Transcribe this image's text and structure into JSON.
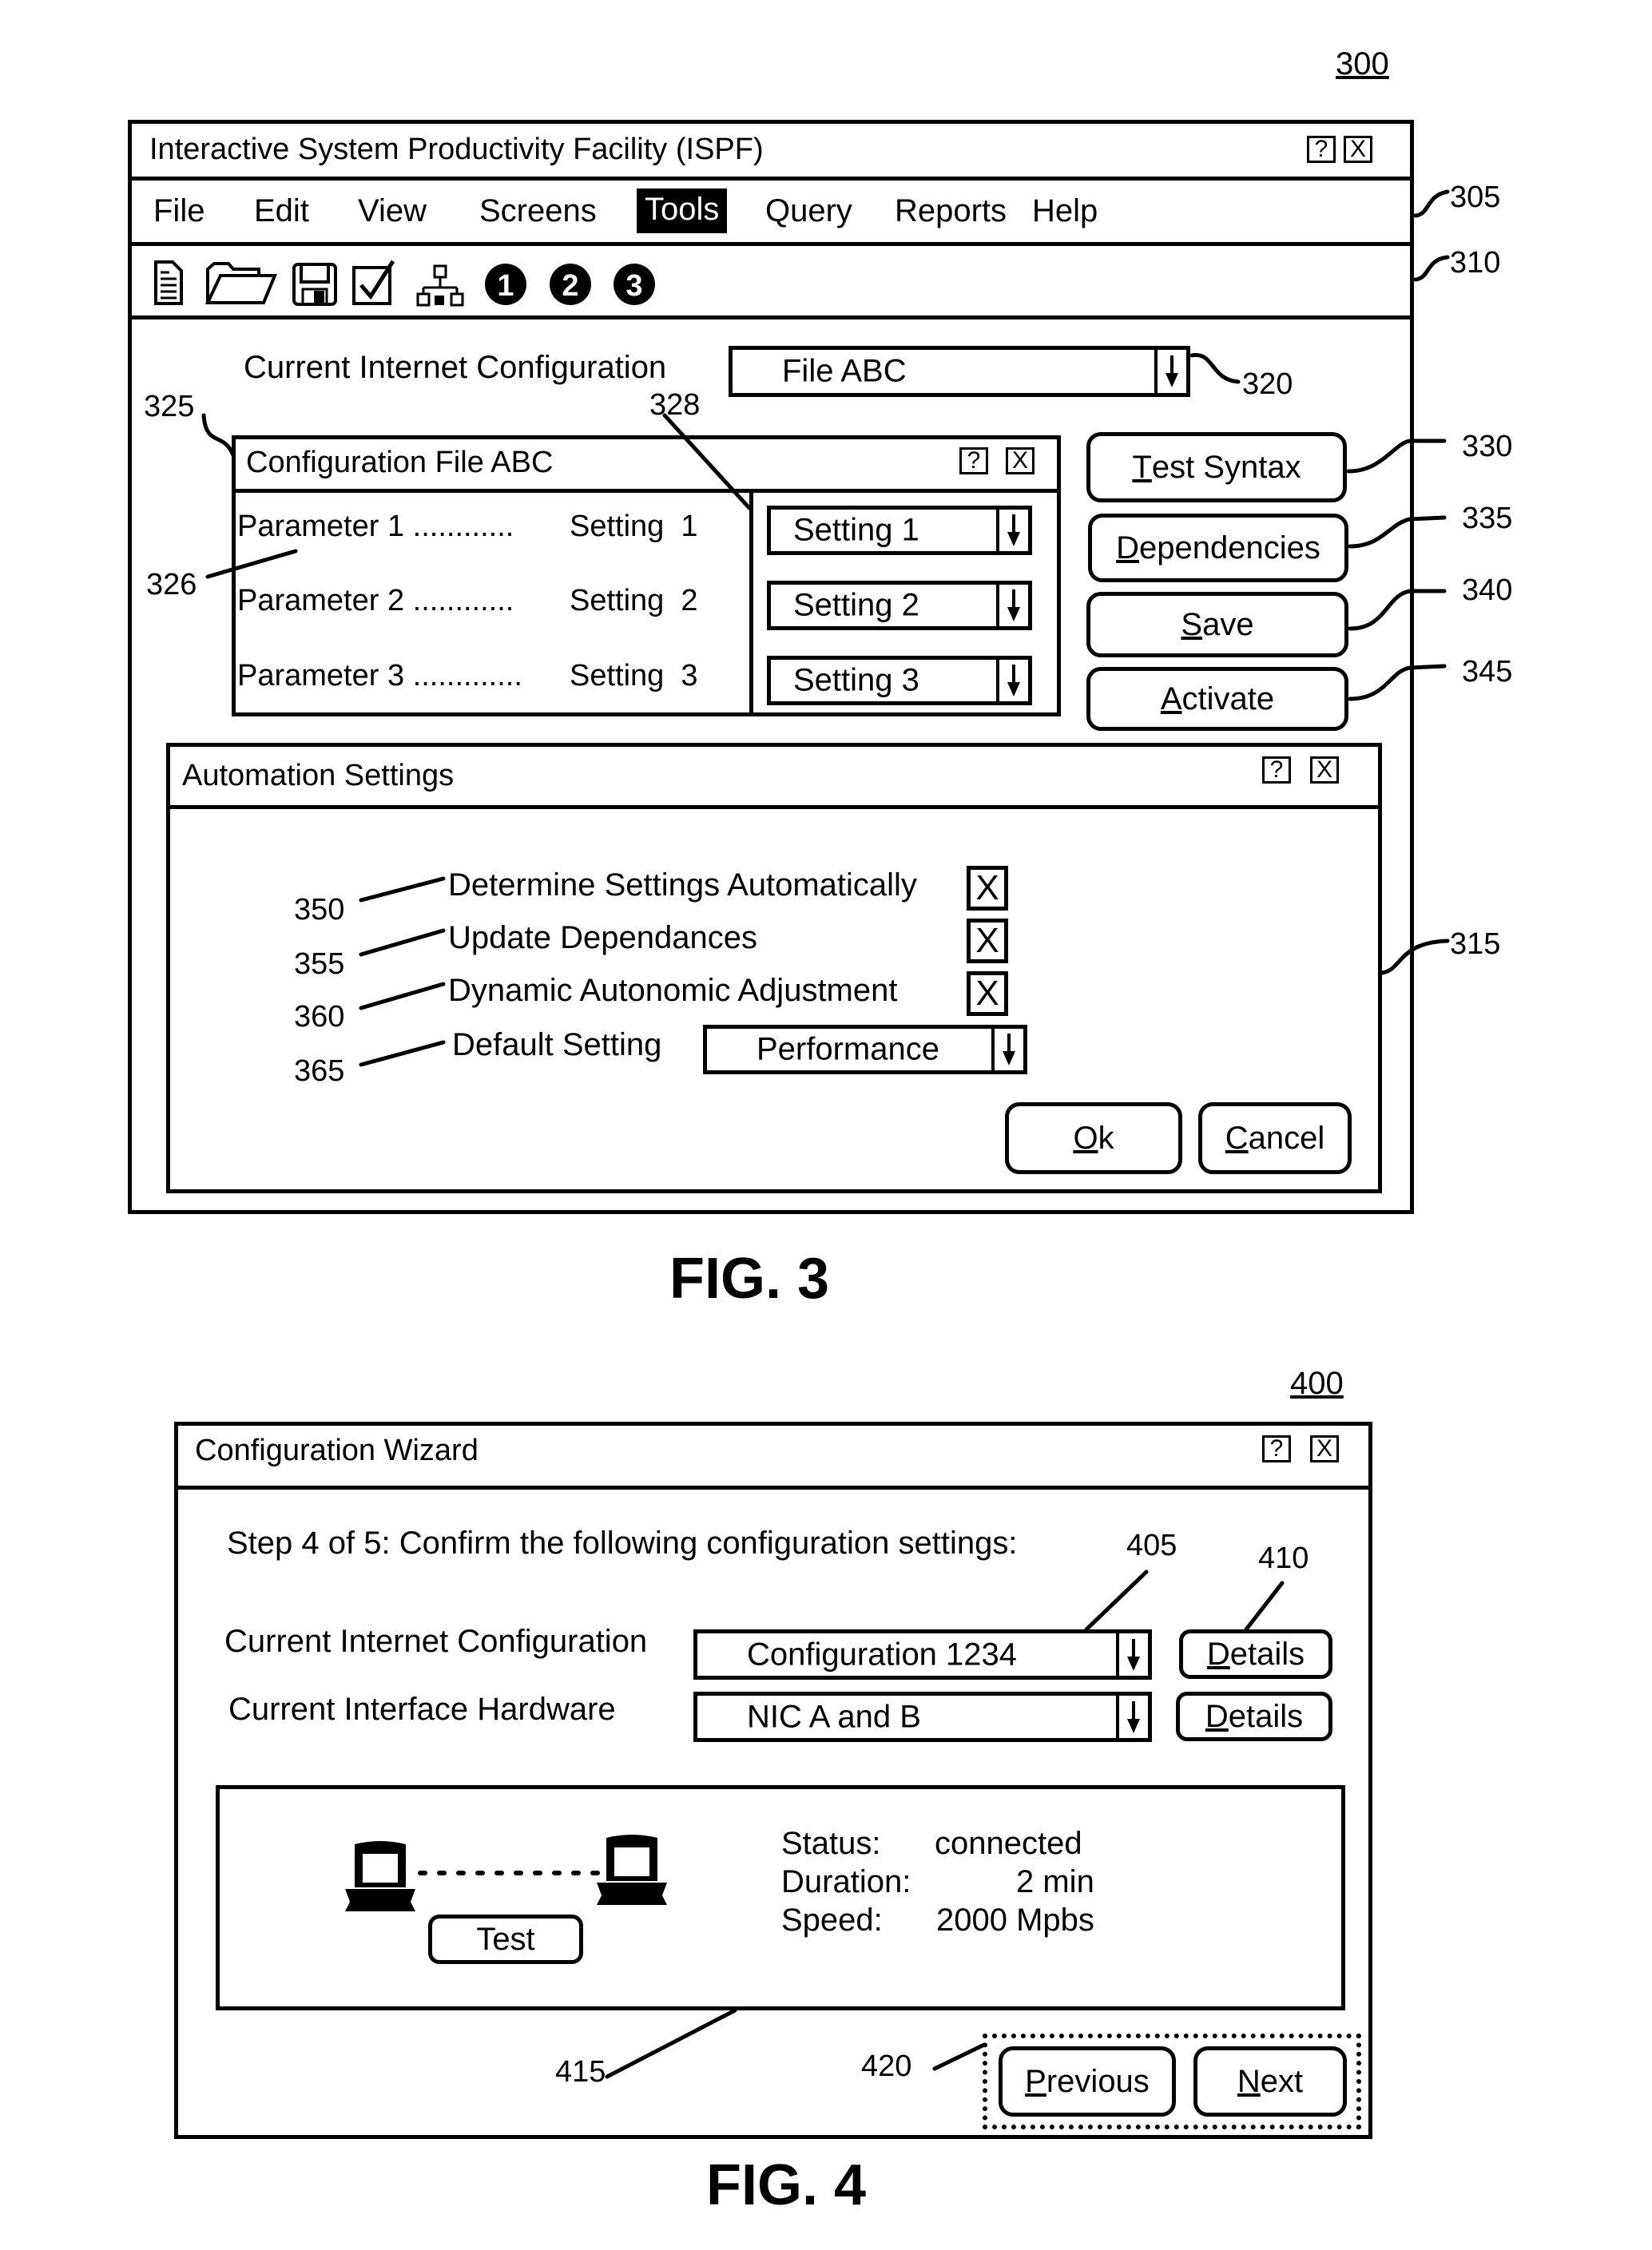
{
  "fig3": {
    "ref_number": "300",
    "caption": "FIG. 3",
    "window": {
      "title": "Interactive System Productivity Facility (ISPF)",
      "help_button": "?",
      "close_button": "X",
      "menu": [
        {
          "label": "File",
          "active": false
        },
        {
          "label": "Edit",
          "active": false
        },
        {
          "label": "View",
          "active": false
        },
        {
          "label": "Screens",
          "active": false
        },
        {
          "label": "Tools",
          "active": true
        },
        {
          "label": "Query",
          "active": false
        },
        {
          "label": "Reports",
          "active": false
        },
        {
          "label": "Help",
          "active": false
        }
      ],
      "toolbar_icons": [
        "new-document-icon",
        "open-folder-icon",
        "save-disk-icon",
        "checkbox-icon",
        "network-icon",
        "step-1-icon",
        "step-2-icon",
        "step-3-icon"
      ],
      "toolbar_glyphs": {
        "step1": "1",
        "step2": "2",
        "step3": "3"
      },
      "current_config_label": "Current Internet Configuration",
      "current_config_value": "File ABC",
      "config_panel": {
        "title": "Configuration File ABC",
        "help_button": "?",
        "close_button": "X",
        "rows": [
          {
            "parameter": "Parameter 1 ............",
            "setting": "Setting  1",
            "dropdown": "Setting 1"
          },
          {
            "parameter": "Parameter 2 ............",
            "setting": "Setting  2",
            "dropdown": "Setting 2"
          },
          {
            "parameter": "Parameter 3 .............",
            "setting": "Setting  3",
            "dropdown": "Setting 3"
          }
        ]
      },
      "buttons": {
        "test_syntax": {
          "mnemonic": "T",
          "rest": "est Syntax"
        },
        "dependencies": {
          "mnemonic": "D",
          "rest": "ependencies"
        },
        "save": {
          "mnemonic": "S",
          "rest": "ave"
        },
        "activate": {
          "mnemonic": "A",
          "rest": "ctivate"
        }
      },
      "automation": {
        "title": "Automation Settings",
        "help_button": "?",
        "close_button": "X",
        "options": [
          {
            "label": "Determine Settings Automatically",
            "checked": true,
            "mark": "X",
            "ref": "350"
          },
          {
            "label": "Update Dependances",
            "checked": true,
            "mark": "X",
            "ref": "355"
          },
          {
            "label": "Dynamic Autonomic Adjustment",
            "checked": true,
            "mark": "X",
            "ref": "360"
          }
        ],
        "default_setting_label": "Default Setting",
        "default_setting_value": "Performance",
        "default_setting_ref": "365",
        "ok": {
          "mnemonic": "O",
          "rest": "k"
        },
        "cancel": {
          "mnemonic": "C",
          "rest": "ancel"
        }
      }
    },
    "refs": {
      "menu_bar": "305",
      "toolbar": "310",
      "automation_panel": "315",
      "config_dropdown": "320",
      "config_panel": "325",
      "parameters": "326",
      "settings_column": "328",
      "test_syntax": "330",
      "dependencies": "335",
      "save": "340",
      "activate": "345"
    }
  },
  "fig4": {
    "ref_number": "400",
    "caption": "FIG. 4",
    "window": {
      "title": "Configuration Wizard",
      "help_button": "?",
      "close_button": "X",
      "step_text": "Step 4 of 5: Confirm the following configuration settings:",
      "internet_config_label": "Current Internet Configuration",
      "internet_config_value": "Configuration 1234",
      "hardware_label": "Current Interface Hardware",
      "hardware_value": "NIC A and B",
      "details_button": {
        "mnemonic": "D",
        "rest": "etails"
      },
      "connection": {
        "test_button": "Test",
        "status_label": "Status:",
        "status_value": "connected",
        "duration_label": "Duration:",
        "duration_value": "2 min",
        "speed_label": "Speed:",
        "speed_value": "2000 Mpbs"
      },
      "previous": {
        "mnemonic": "P",
        "rest": "revious"
      },
      "next": {
        "mnemonic": "N",
        "rest": "ext"
      }
    },
    "refs": {
      "config_dropdown": "405",
      "details": "410",
      "connection_panel": "415",
      "nav_buttons": "420"
    }
  }
}
